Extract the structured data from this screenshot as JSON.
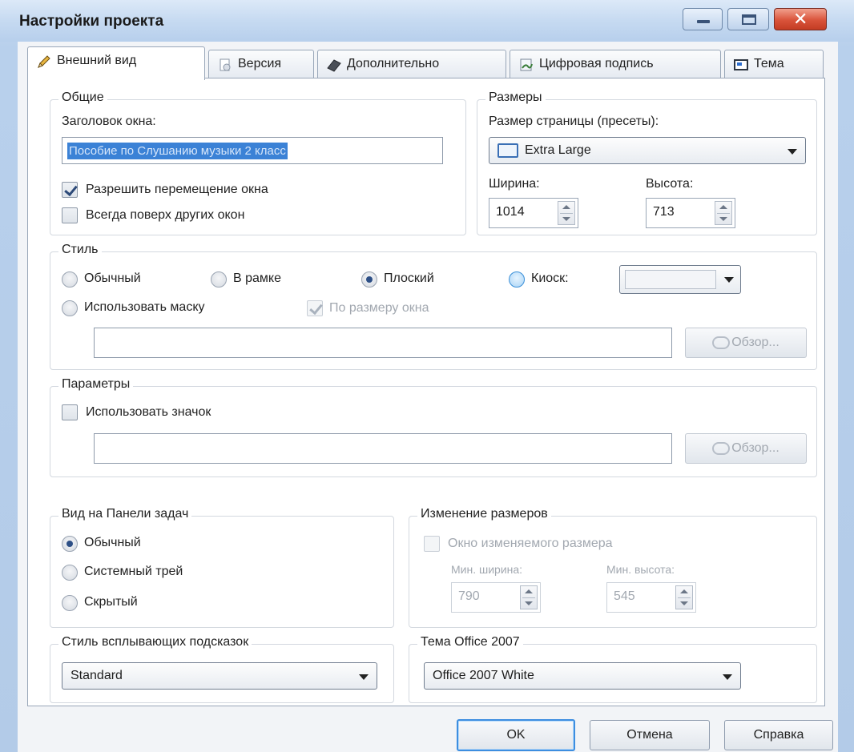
{
  "window": {
    "title": "Настройки проекта"
  },
  "tabs": [
    {
      "label": "Внешний вид",
      "icon": "pencil-icon"
    },
    {
      "label": "Версия",
      "icon": "version-icon"
    },
    {
      "label": "Дополнительно",
      "icon": "eraser-icon"
    },
    {
      "label": "Цифровая подпись",
      "icon": "signature-icon"
    },
    {
      "label": "Тема",
      "icon": "theme-icon"
    }
  ],
  "general": {
    "title": "Общие",
    "caption_label": "Заголовок окна:",
    "caption_value": "Пособие по Слушанию музыки 2 класс",
    "allow_move": "Разрешить перемещение окна",
    "always_on_top": "Всегда поверх других окон"
  },
  "sizes": {
    "title": "Размеры",
    "preset_label": "Размер страницы (пресеты):",
    "preset_value": "Extra Large",
    "width_label": "Ширина:",
    "width_value": "1014",
    "height_label": "Высота:",
    "height_value": "713"
  },
  "style": {
    "title": "Стиль",
    "normal": "Обычный",
    "framed": "В рамке",
    "flat": "Плоский",
    "kiosk": "Киоск:",
    "use_mask": "Использовать маску",
    "fit_window": "По размеру окна",
    "browse": "Обзор..."
  },
  "params": {
    "title": "Параметры",
    "use_icon": "Использовать значок",
    "browse": "Обзор..."
  },
  "taskbar": {
    "title": "Вид на Панели задач",
    "normal": "Обычный",
    "tray": "Системный трей",
    "hidden": "Скрытый"
  },
  "resize": {
    "title": "Изменение размеров",
    "resizable": "Окно изменяемого размера",
    "min_width_label": "Мин. ширина:",
    "min_width_value": "790",
    "min_height_label": "Мин. высота:",
    "min_height_value": "545"
  },
  "tooltip_style": {
    "title": "Стиль всплывающих подсказок",
    "value": "Standard"
  },
  "office_theme": {
    "title": "Тема Office 2007",
    "value": "Office 2007 White"
  },
  "buttons": {
    "ok": "OK",
    "cancel": "Отмена",
    "help": "Справка"
  },
  "colors": {
    "accent": "#3d8ee0",
    "selection": "#3b82d6",
    "titlebar": "#c6daf1",
    "close": "#d9533a"
  }
}
